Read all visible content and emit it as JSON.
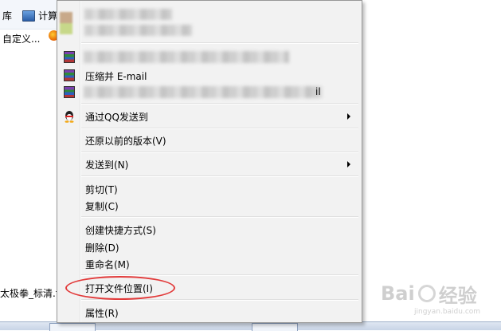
{
  "background": {
    "nav_library": "库",
    "nav_computer": "计算",
    "nav_custom": "自定义...",
    "file_name": "太极拳_标清.f"
  },
  "context_menu": {
    "items": [
      {
        "label": "压缩并 E-mail",
        "icon": "winrar-icon"
      },
      {
        "label": "通过QQ发送到",
        "icon": "qq-penguin-icon",
        "submenu": true
      },
      {
        "label": "还原以前的版本(V)"
      },
      {
        "label": "发送到(N)",
        "submenu": true
      },
      {
        "label": "剪切(T)"
      },
      {
        "label": "复制(C)"
      },
      {
        "label": "创建快捷方式(S)"
      },
      {
        "label": "删除(D)"
      },
      {
        "label": "重命名(M)"
      },
      {
        "label": "打开文件位置(I)"
      },
      {
        "label": "属性(R)"
      }
    ],
    "blurred_trailing_text": "il"
  },
  "watermark": {
    "brand": "Bai",
    "brand2": "经验",
    "sub": "jingyan.baidu.com"
  },
  "colors": {
    "highlight_circle": "#e23b3b",
    "menu_bg": "#f2f2f2"
  }
}
